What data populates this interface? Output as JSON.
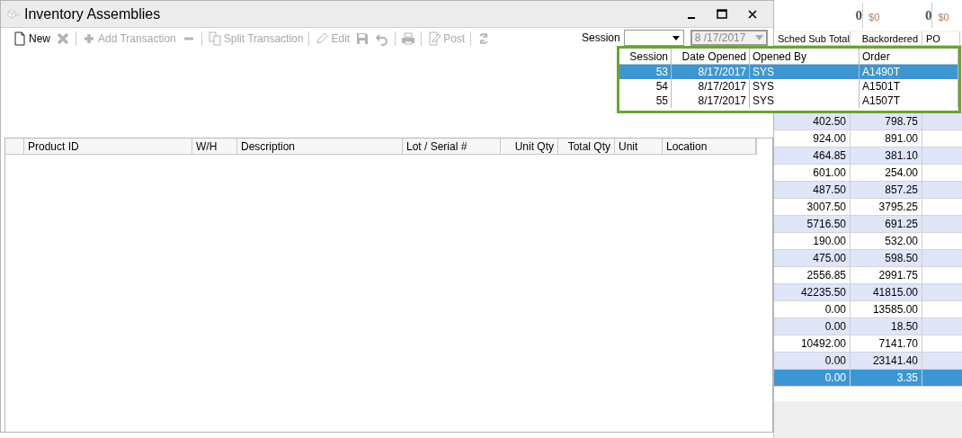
{
  "background_app": {
    "summary": [
      "0",
      "$0",
      "0",
      "$0"
    ],
    "columns": [
      "Sched Sub Total",
      "Backordered",
      "PO"
    ],
    "rows": [
      {
        "cells": [
          "402.50",
          "798.75"
        ],
        "selected": false
      },
      {
        "cells": [
          "924.00",
          "891.00"
        ],
        "selected": false
      },
      {
        "cells": [
          "464.85",
          "381.10"
        ],
        "selected": false
      },
      {
        "cells": [
          "601.00",
          "254.00"
        ],
        "selected": false
      },
      {
        "cells": [
          "487.50",
          "857.25"
        ],
        "selected": false
      },
      {
        "cells": [
          "3007.50",
          "3795.25"
        ],
        "selected": false
      },
      {
        "cells": [
          "5716.50",
          "691.25"
        ],
        "selected": false
      },
      {
        "cells": [
          "190.00",
          "532.00"
        ],
        "selected": false
      },
      {
        "cells": [
          "475.00",
          "598.50"
        ],
        "selected": false
      },
      {
        "cells": [
          "2556.85",
          "2991.75"
        ],
        "selected": false
      },
      {
        "cells": [
          "42235.50",
          "41815.00"
        ],
        "selected": false
      },
      {
        "cells": [
          "0.00",
          "13585.00"
        ],
        "selected": false
      },
      {
        "cells": [
          "0.00",
          "18.50"
        ],
        "selected": false
      },
      {
        "cells": [
          "10492.00",
          "7141.70"
        ],
        "selected": false
      },
      {
        "cells": [
          "0.00",
          "23141.40"
        ],
        "selected": false
      },
      {
        "cells": [
          "0.00",
          "3.35"
        ],
        "selected": true
      }
    ]
  },
  "window": {
    "title": "Inventory Assemblies"
  },
  "toolbar": [
    {
      "kind": "new",
      "label": "New",
      "disabled": false,
      "separator_after": false
    },
    {
      "kind": "delete",
      "disabled": true,
      "separator_after": true
    },
    {
      "kind": "add",
      "label": "Add Transaction",
      "disabled": true,
      "separator_after": false
    },
    {
      "kind": "remove",
      "disabled": true,
      "separator_after": true
    },
    {
      "kind": "split",
      "label": "Split Transaction",
      "disabled": true,
      "separator_after": true
    },
    {
      "kind": "edit",
      "label": "Edit",
      "disabled": true,
      "separator_after": false
    },
    {
      "kind": "save",
      "disabled": true,
      "separator_after": false
    },
    {
      "kind": "undo",
      "disabled": true,
      "separator_after": true
    },
    {
      "kind": "print",
      "disabled": true,
      "separator_after": true
    },
    {
      "kind": "post",
      "label": "Post",
      "disabled": true,
      "separator_after": true
    },
    {
      "kind": "refresh",
      "disabled": true,
      "separator_after": false
    }
  ],
  "session": {
    "label": "Session",
    "date": "8 /17/2017",
    "date_disabled": true
  },
  "session_dropdown": {
    "columns": [
      "Session",
      "Date Opened",
      "Opened By",
      "Order"
    ],
    "rows": [
      {
        "cells": [
          "53",
          "8/17/2017",
          "SYS",
          "A1490T"
        ],
        "selected": true
      },
      {
        "cells": [
          "54",
          "8/17/2017",
          "SYS",
          "A1501T"
        ],
        "selected": false
      },
      {
        "cells": [
          "55",
          "8/17/2017",
          "SYS",
          "A1507T"
        ],
        "selected": false
      }
    ]
  },
  "grid": {
    "columns": [
      "Product ID",
      "W/H",
      "Description",
      "Lot / Serial #",
      "Unit Qty",
      "Total Qty",
      "Unit",
      "Location"
    ]
  }
}
